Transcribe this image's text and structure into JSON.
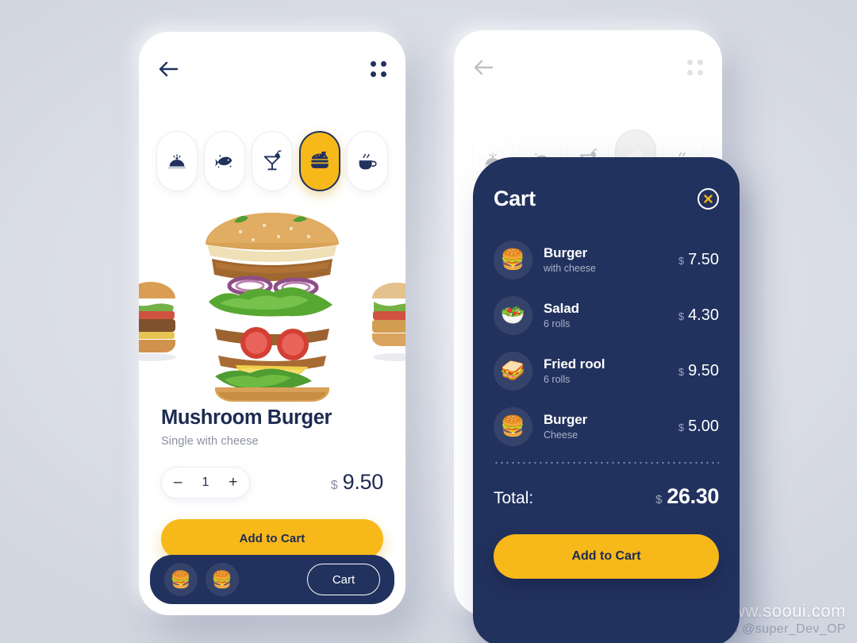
{
  "theme": {
    "navy": "#22325e",
    "yellow": "#F7B81A",
    "text_dark": "#1d2b51",
    "muted": "#8b90a0",
    "background": "#dfe2ea"
  },
  "left_screen": {
    "topbar": {
      "back_label": "back-arrow",
      "menu_label": "grid-menu"
    },
    "categories": [
      {
        "id": "dish",
        "label": "Dish",
        "icon": "cloche-icon",
        "active": false
      },
      {
        "id": "fish",
        "label": "Fish",
        "icon": "fish-icon",
        "active": false
      },
      {
        "id": "drinks",
        "label": "Drinks",
        "icon": "cocktail-glass-icon",
        "active": false
      },
      {
        "id": "burger",
        "label": "Burger",
        "icon": "burger-icon",
        "active": true
      },
      {
        "id": "coffee",
        "label": "Coffee",
        "icon": "coffee-cup-icon",
        "active": false
      }
    ],
    "product": {
      "title": "Mushroom Burger",
      "subtitle": "Single with cheese",
      "quantity": "1",
      "decrement_label": "–",
      "increment_label": "+",
      "currency": "$",
      "price": "9.50",
      "cta_label": "Add to Cart"
    },
    "bottom_bar": {
      "avatars": [
        "🍔",
        "🍔"
      ],
      "cart_label": "Cart"
    }
  },
  "right_screen": {
    "cart": {
      "title": "Cart",
      "close_label": "×",
      "items": [
        {
          "name": "Burger",
          "sub": "with cheese",
          "currency": "$",
          "price": "7.50",
          "thumb": "🍔"
        },
        {
          "name": "Salad",
          "sub": "6 rolls",
          "currency": "$",
          "price": "4.30",
          "thumb": "🥗"
        },
        {
          "name": "Fried rool",
          "sub": "6 rolls",
          "currency": "$",
          "price": "9.50",
          "thumb": "🥪"
        },
        {
          "name": "Burger",
          "sub": "Cheese",
          "currency": "$",
          "price": "5.00",
          "thumb": "🍔"
        }
      ],
      "total_label": "Total:",
      "total_currency": "$",
      "total_value": "26.30",
      "cta_label": "Add to Cart"
    }
  },
  "watermark": {
    "line1": "www.sooui.com",
    "line2": "CSDN @super_Dev_OP"
  }
}
